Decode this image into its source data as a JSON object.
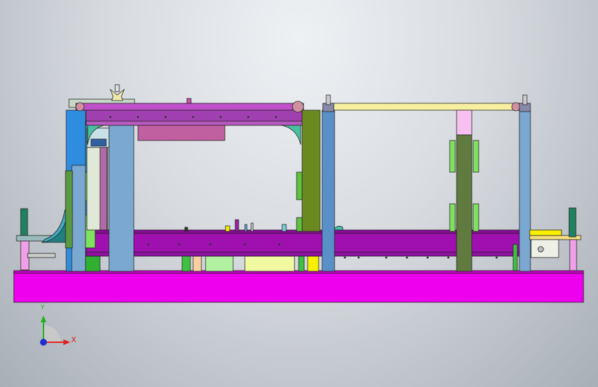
{
  "app": {
    "title": ""
  },
  "triad": {
    "x_label": "X",
    "y_label": "Y",
    "x_color": "#e02020",
    "y_color": "#20b020",
    "z_color": "#2030d0"
  },
  "palette": {
    "base": "#ee00ee",
    "beam": "#a010b0",
    "top_beam": "#c050c8",
    "blue_post": "#4a9ae0",
    "light_blue_post": "#7aa8d0",
    "olive": "#6a8a20",
    "green": "#30c030",
    "yellow_bar": "#f6f0a0",
    "pink": "#f0a0e8",
    "teal": "#208080",
    "background_center": "#eef1f4",
    "background_edge": "#a9afb7"
  }
}
